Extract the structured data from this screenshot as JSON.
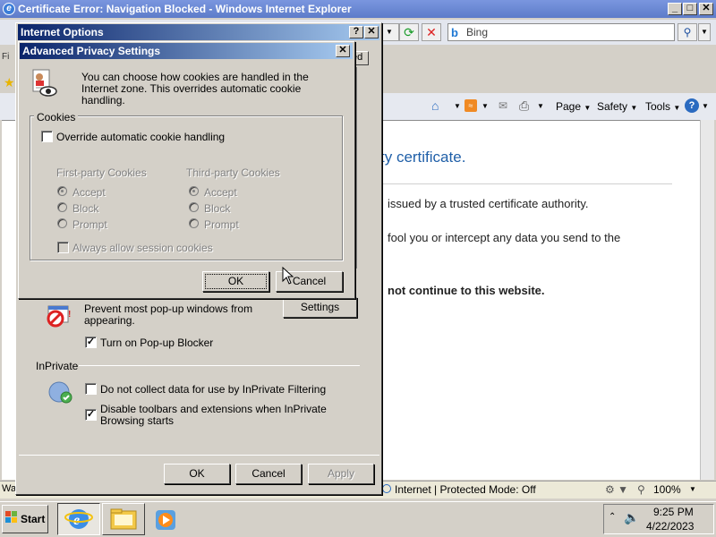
{
  "ie": {
    "title": "Certificate Error: Navigation Blocked - Windows Internet Explorer",
    "search_placeholder": "Bing",
    "command_bar": [
      "Page",
      "Safety",
      "Tools"
    ],
    "content": {
      "heading_fragment": "ty certificate.",
      "line1_fragment": "issued by a trusted certificate authority.",
      "line2_fragment": "fool you or intercept any data you send to the",
      "line3_fragment": "not continue to this website."
    },
    "status": {
      "left_fragment": "Wa",
      "zone": "Internet | Protected Mode: Off",
      "zoom": "100%"
    },
    "tab_fragment": "Fi",
    "toolbar_tab_fragment": "ed"
  },
  "internet_options": {
    "title": "Internet Options",
    "popup_text": "Prevent most pop-up windows from appearing.",
    "popup_checkbox": "Turn on Pop-up Blocker",
    "popup_checked": true,
    "settings_button": "Settings",
    "inprivate_heading": "InPrivate",
    "inprivate_cb1": "Do not collect data for use by InPrivate Filtering",
    "inprivate_cb1_checked": false,
    "inprivate_cb2": "Disable toolbars and extensions when InPrivate Browsing starts",
    "inprivate_cb2_checked": true,
    "ok_button": "OK",
    "cancel_button": "Cancel",
    "apply_button": "Apply"
  },
  "advanced_privacy": {
    "title": "Advanced Privacy Settings",
    "description": "You can choose how cookies are handled in the Internet zone.  This overrides automatic cookie handling.",
    "group_label": "Cookies",
    "override_checkbox": "Override automatic cookie handling",
    "override_checked": false,
    "first_party": {
      "heading": "First-party Cookies",
      "options": [
        "Accept",
        "Block",
        "Prompt"
      ],
      "selected": "Accept"
    },
    "third_party": {
      "heading": "Third-party Cookies",
      "options": [
        "Accept",
        "Block",
        "Prompt"
      ],
      "selected": "Accept"
    },
    "session_checkbox": "Always allow session cookies",
    "session_checked": false,
    "ok_button": "OK",
    "cancel_button": "Cancel"
  },
  "taskbar": {
    "start_label": "Start",
    "time": "9:25 PM",
    "date": "4/22/2023"
  },
  "colors": {
    "titlebar_active": "#0a246a",
    "ie_titlebar": "#5d7cc9",
    "dialog_face": "#d4d0c8"
  }
}
